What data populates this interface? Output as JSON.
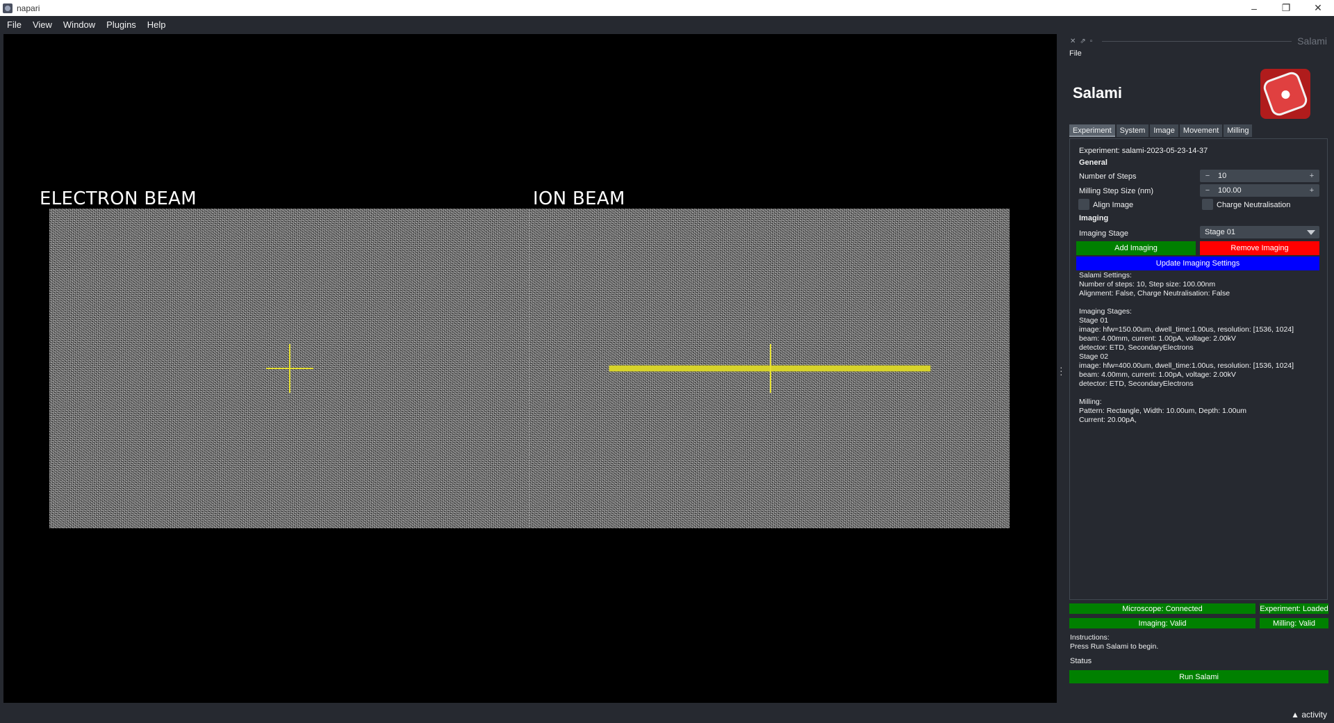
{
  "window": {
    "title": "napari",
    "minimize": "–",
    "maximize": "❐",
    "close": "✕"
  },
  "menu": [
    "File",
    "View",
    "Window",
    "Plugins",
    "Help"
  ],
  "viewer": {
    "electron_label": "ELECTRON BEAM",
    "ion_label": "ION BEAM"
  },
  "dock": {
    "title": "Salami",
    "file_menu": "File",
    "app_title": "Salami",
    "tabs": [
      "Experiment",
      "System",
      "Image",
      "Movement",
      "Milling"
    ],
    "experiment_label": "Experiment: salami-2023-05-23-14-37",
    "general_header": "General",
    "steps_label": "Number of Steps",
    "steps_value": "10",
    "step_size_label": "Milling Step Size (nm)",
    "step_size_value": "100.00",
    "align_label": "Align Image",
    "charge_label": "Charge Neutralisation",
    "imaging_header": "Imaging",
    "imaging_stage_label": "Imaging Stage",
    "imaging_stage_value": "Stage 01",
    "add_imaging": "Add Imaging",
    "remove_imaging": "Remove Imaging",
    "update_imaging": "Update Imaging Settings",
    "info_text": "Salami Settings:\nNumber of steps: 10, Step size: 100.00nm\nAlignment: False, Charge Neutralisation: False\n\nImaging Stages:\nStage 01\nimage: hfw=150.00um, dwell_time:1.00us, resolution: [1536, 1024]\nbeam: 4.00mm, current: 1.00pA, voltage: 2.00kV\ndetector: ETD, SecondaryElectrons\nStage 02\nimage: hfw=400.00um, dwell_time:1.00us, resolution: [1536, 1024]\nbeam: 4.00mm, current: 1.00pA, voltage: 2.00kV\ndetector: ETD, SecondaryElectrons\n\nMilling:\nPattern: Rectangle, Width: 10.00um, Depth: 1.00um\nCurrent: 20.00pA,",
    "status_microscope": "Microscope: Connected",
    "status_experiment": "Experiment: Loaded",
    "status_imaging": "Imaging: Valid",
    "status_milling": "Milling: Valid",
    "instructions_label": "Instructions:",
    "instructions_text": "Press Run Salami to begin.",
    "status_label": "Status",
    "run_button": "Run Salami"
  },
  "activity": "▲ activity",
  "colors": {
    "background": "#262930",
    "panel": "#414851",
    "green": "#008000",
    "red": "#ff0000",
    "blue": "#0000ff",
    "crosshair": "#e6e033"
  }
}
